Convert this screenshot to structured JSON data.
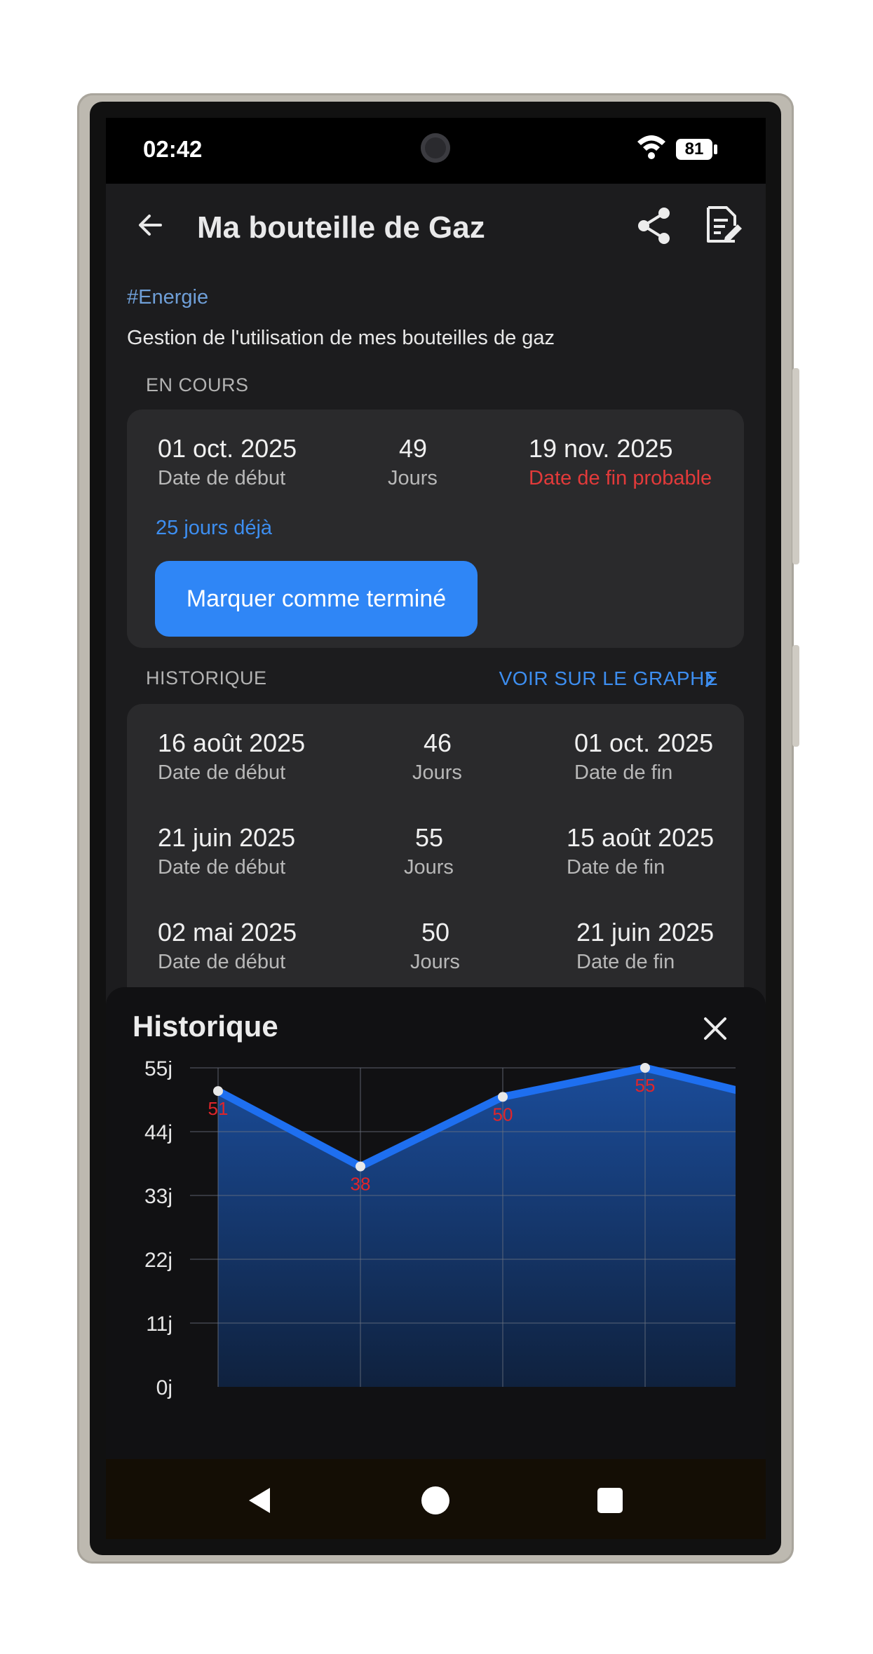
{
  "status": {
    "time": "02:42",
    "battery": "81"
  },
  "appbar": {
    "title": "Ma bouteille de Gaz",
    "back_icon": "arrow-left-icon",
    "share_icon": "share-icon",
    "edit_icon": "edit-note-icon"
  },
  "tag": "#Energie",
  "description": "Gestion de l'utilisation de mes bouteilles de gaz",
  "current": {
    "label": "EN COURS",
    "start_date": "01 oct. 2025",
    "start_caption": "Date de début",
    "days": "49",
    "days_caption": "Jours",
    "end_date": "19 nov. 2025",
    "end_caption": "Date de fin probable",
    "elapsed": "25 jours déjà",
    "button": "Marquer comme terminé"
  },
  "history": {
    "label": "HISTORIQUE",
    "link": "VOIR SUR LE GRAPHE",
    "rows": [
      {
        "start": "16 août 2025",
        "start_caption": "Date de début",
        "days": "46",
        "days_caption": "Jours",
        "end": "01 oct. 2025",
        "end_caption": "Date de fin"
      },
      {
        "start": "21 juin 2025",
        "start_caption": "Date de début",
        "days": "55",
        "days_caption": "Jours",
        "end": "15 août 2025",
        "end_caption": "Date de fin"
      },
      {
        "start": "02 mai 2025",
        "start_caption": "Date de début",
        "days": "50",
        "days_caption": "Jours",
        "end": "21 juin 2025",
        "end_caption": "Date de fin"
      }
    ]
  },
  "sheet": {
    "title": "Historique",
    "close_icon": "close-icon"
  },
  "chart_data": {
    "type": "area",
    "title": "Historique",
    "y_tick_labels": [
      "0j",
      "11j",
      "22j",
      "33j",
      "44j",
      "55j"
    ],
    "ylim": [
      0,
      55
    ],
    "points": [
      51,
      38,
      50,
      55,
      49
    ],
    "data_labels": [
      "51",
      "38",
      "50",
      "55"
    ],
    "grid": true,
    "line_color": "#1e6ff0",
    "label_color": "#e0252a"
  },
  "colors": {
    "accent": "#2f86f6",
    "warning": "#e23a3a",
    "tag": "#6f9fd8"
  },
  "nav": {
    "back": "nav-back-icon",
    "home": "nav-home-icon",
    "recents": "nav-recents-icon"
  }
}
